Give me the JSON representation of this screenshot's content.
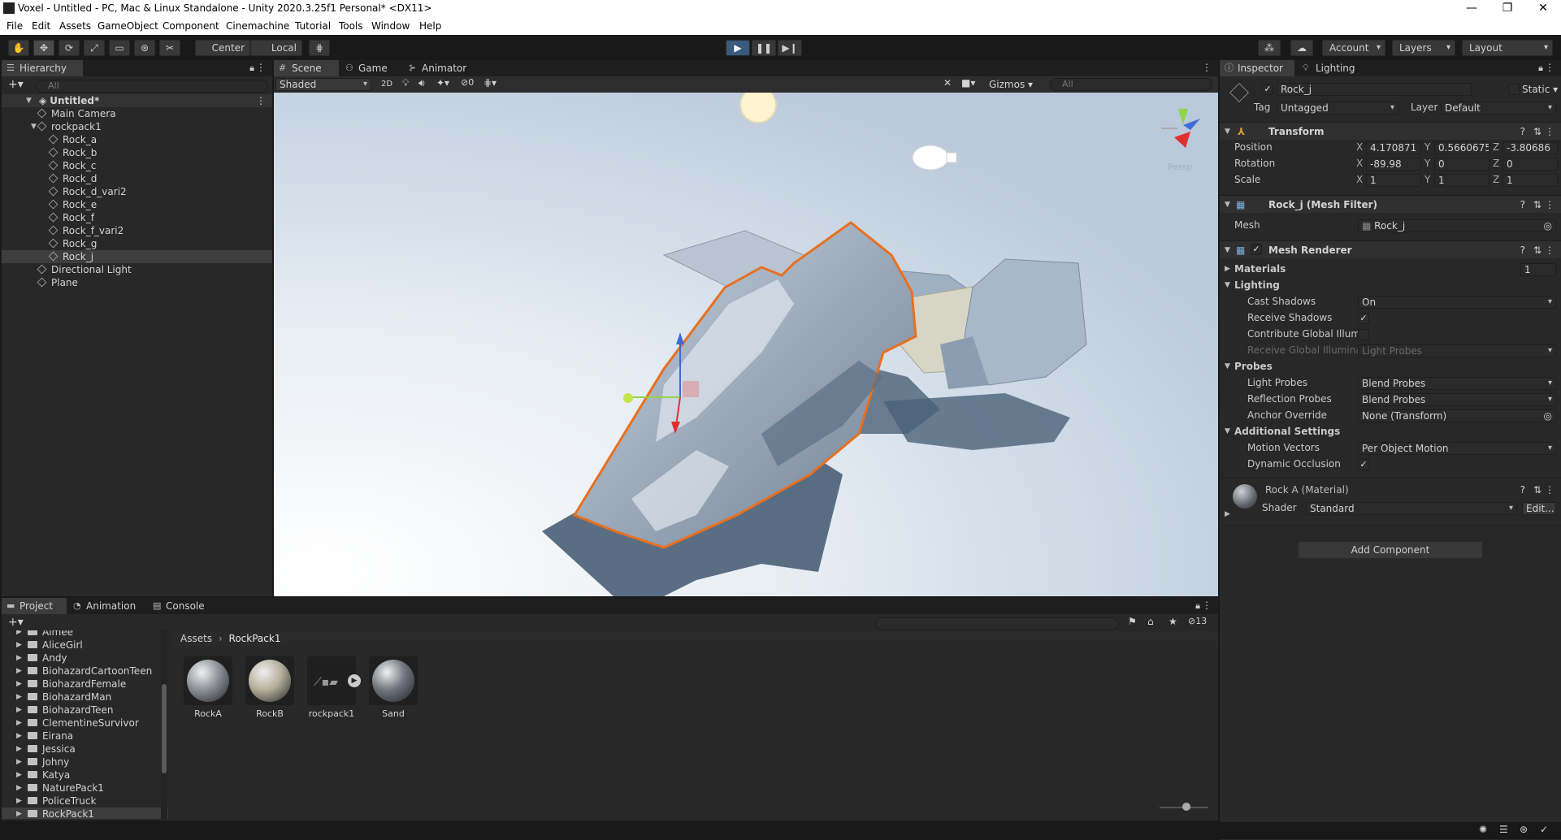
{
  "window": {
    "title": "Voxel - Untitled - PC, Mac & Linux Standalone - Unity 2020.3.25f1 Personal* <DX11>",
    "min_glyph": "—",
    "max_glyph": "❐",
    "close_glyph": "✕"
  },
  "menu": [
    "File",
    "Edit",
    "Assets",
    "GameObject",
    "Component",
    "Cinemachine",
    "Tutorial",
    "Tools",
    "Window",
    "Help"
  ],
  "toolbar": {
    "pivot_label": "Center",
    "space_label": "Local",
    "account_label": "Account",
    "layers_label": "Layers",
    "layout_label": "Layout",
    "play_icon": "play-icon",
    "pause_icon": "pause-icon",
    "step_icon": "step-icon"
  },
  "hierarchy": {
    "tab": "Hierarchy",
    "search_placeholder": "All",
    "scene": "Untitled*",
    "items": [
      {
        "label": "Main Camera",
        "indent": 1
      },
      {
        "label": "rockpack1",
        "indent": 1
      },
      {
        "label": "Rock_a",
        "indent": 2
      },
      {
        "label": "Rock_b",
        "indent": 2
      },
      {
        "label": "Rock_c",
        "indent": 2
      },
      {
        "label": "Rock_d",
        "indent": 2
      },
      {
        "label": "Rock_d_vari2",
        "indent": 2
      },
      {
        "label": "Rock_e",
        "indent": 2
      },
      {
        "label": "Rock_f",
        "indent": 2
      },
      {
        "label": "Rock_f_vari2",
        "indent": 2
      },
      {
        "label": "Rock_g",
        "indent": 2
      },
      {
        "label": "Rock_j",
        "indent": 2,
        "selected": true
      },
      {
        "label": "Directional Light",
        "indent": 1
      },
      {
        "label": "Plane",
        "indent": 1
      }
    ]
  },
  "scene_view": {
    "tabs": [
      "Scene",
      "Game",
      "Animator"
    ],
    "shading_mode": "Shaded",
    "mode_2d": "2D",
    "hidden_count": "0",
    "gizmos_label": "Gizmos",
    "search_placeholder": "All",
    "persp_label": "Persp",
    "selection_color": "#e8701f"
  },
  "inspector": {
    "tabs": [
      "Inspector",
      "Lighting"
    ],
    "object_name": "Rock_j",
    "static_label": "Static",
    "tag_label": "Tag",
    "tag_value": "Untagged",
    "layer_label": "Layer",
    "layer_value": "Default",
    "transform": {
      "title": "Transform",
      "position_label": "Position",
      "rotation_label": "Rotation",
      "scale_label": "Scale",
      "x_axis": "X",
      "y_axis": "Y",
      "z_axis": "Z",
      "position": {
        "x": "4.170871",
        "y": "0.5660675",
        "z": "-3.80686"
      },
      "rotation": {
        "x": "-89.98",
        "y": "0",
        "z": "0"
      },
      "scale": {
        "x": "1",
        "y": "1",
        "z": "1"
      }
    },
    "mesh_filter": {
      "title": "Rock_j (Mesh Filter)",
      "mesh_label": "Mesh",
      "mesh_value": "Rock_j"
    },
    "mesh_renderer": {
      "title": "Mesh Renderer",
      "materials_label": "Materials",
      "materials_count": "1",
      "lighting_label": "Lighting",
      "cast_shadows_label": "Cast Shadows",
      "cast_shadows_value": "On",
      "receive_shadows_label": "Receive Shadows",
      "contribute_gi_label": "Contribute Global Illumir",
      "receive_gi_label": "Receive Global Illuminat",
      "receive_gi_value": "Light Probes",
      "probes_label": "Probes",
      "light_probes_label": "Light Probes",
      "light_probes_value": "Blend Probes",
      "reflection_probes_label": "Reflection Probes",
      "reflection_probes_value": "Blend Probes",
      "anchor_override_label": "Anchor Override",
      "anchor_override_value": "None (Transform)",
      "additional_label": "Additional Settings",
      "motion_vectors_label": "Motion Vectors",
      "motion_vectors_value": "Per Object Motion",
      "dynamic_occlusion_label": "Dynamic Occlusion"
    },
    "material": {
      "title": "Rock A (Material)",
      "shader_label": "Shader",
      "shader_value": "Standard",
      "edit_label": "Edit..."
    },
    "add_component": "Add Component"
  },
  "project": {
    "tabs": [
      "Project",
      "Animation",
      "Console"
    ],
    "breadcrumb_root": "Assets",
    "breadcrumb_sep": "›",
    "breadcrumb_current": "RockPack1",
    "hidden_count": "13",
    "folders": [
      "Aimee",
      "AliceGirl",
      "Andy",
      "BiohazardCartoonTeen",
      "BiohazardFemale",
      "BiohazardMan",
      "BiohazardTeen",
      "ClementineSurvivor",
      "Eirana",
      "Jessica",
      "Johny",
      "Katya",
      "NaturePack1",
      "PoliceTruck",
      "RockPack1"
    ],
    "assets": [
      {
        "name": "RockA",
        "kind": "material",
        "color": "#8a8f96"
      },
      {
        "name": "RockB",
        "kind": "material",
        "color": "#b5ad9a"
      },
      {
        "name": "rockpack1",
        "kind": "model",
        "color": "#3a3a3a"
      },
      {
        "name": "Sand",
        "kind": "material",
        "color": "#6f757d"
      }
    ]
  }
}
